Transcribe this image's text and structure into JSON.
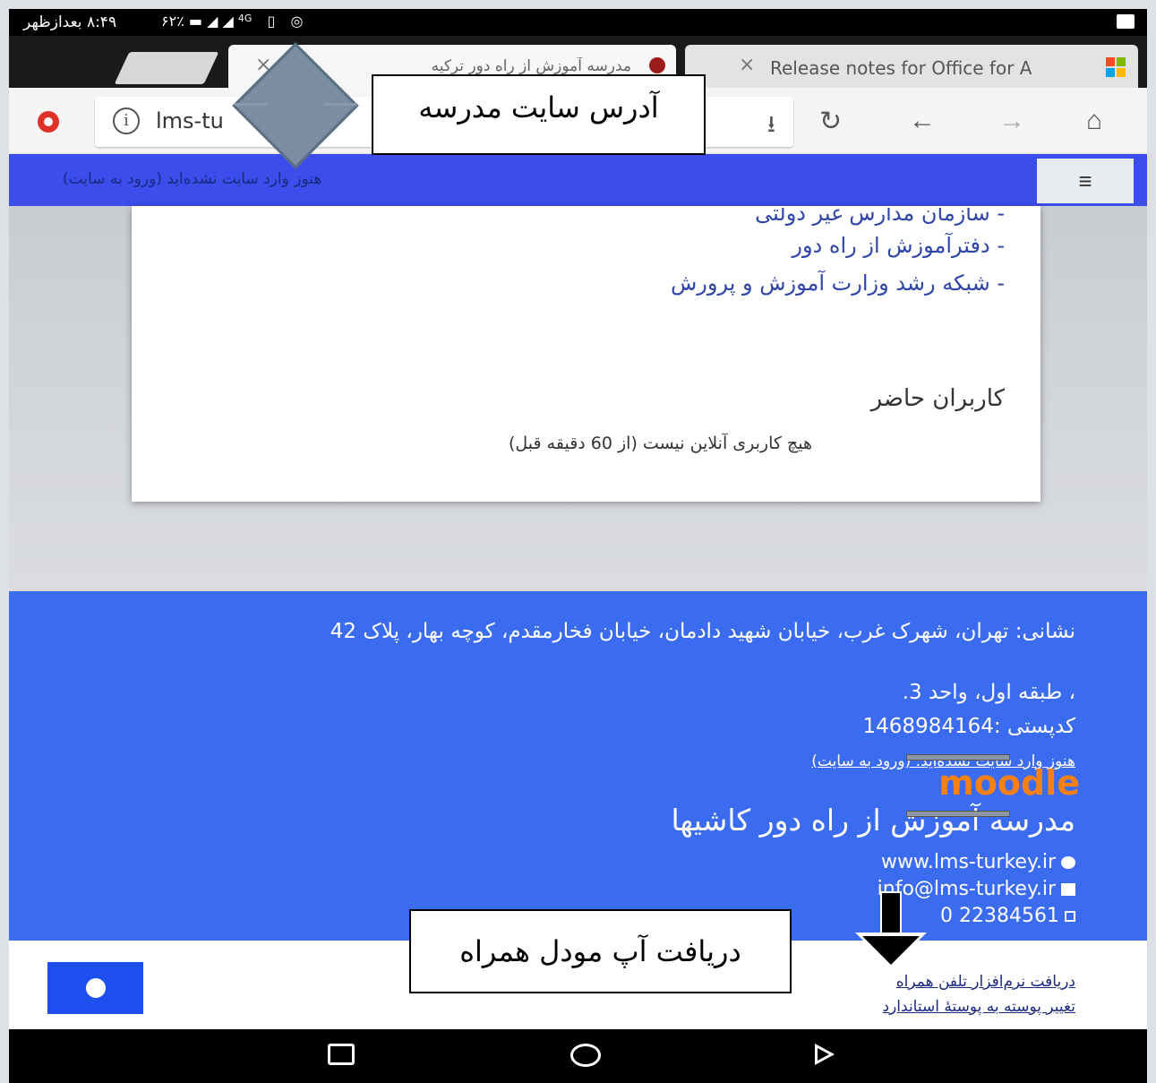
{
  "status_bar": {
    "time": "۸:۴۹ بعدازظهر",
    "battery": "۶۲٪",
    "network": "4G"
  },
  "tabs": [
    {
      "title": "مدرسه آموزش از راه دور ترکیه",
      "close": "×",
      "active": true
    },
    {
      "title": "Release notes for Office for A",
      "close": "×",
      "active": false
    }
  ],
  "toolbar": {
    "url": "lms-tu",
    "info_icon": "i",
    "download_icon": "⭳",
    "reload_icon": "↻",
    "back_icon": "←",
    "forward_icon": "→",
    "home_icon": "⌂"
  },
  "navbar": {
    "login_status": "هنوز وارد سایت نشده‌اید (ورود به سایت)",
    "menu_icon": "≡"
  },
  "card": {
    "links": [
      "- سازمان مدارس غیر دولتی",
      "- دفترآموزش از راه دور",
      "- شبکه رشد وزارت آموزش و پرورش"
    ],
    "online_title": "کاربران حاضر",
    "online_text": "هیچ کاربری آنلاین نیست (از 60 دقیقه قبل)"
  },
  "footer": {
    "address": "نشانی: تهران، شهرک غرب، خیابان شهید دادمان، خیابان فخارمقدم، کوچه بهار، پلاک 42",
    "floor": "، طبقه اول، واحد 3.",
    "postal": "کدپستی :1468984164",
    "login_status": "هنوز وارد سایت نشده‌اید. (ورود به سایت)",
    "moodle_logo": "moodle",
    "school_name": "مدرسه آموزش از راه دور کاشیها",
    "website": "www.lms-turkey.ir",
    "email": "info@lms-turkey.ir",
    "phone": "0  22384561",
    "mobile_app_link": "دریافت نرم‌افزار تلفن همراه",
    "standard_theme_link": "تغییر پوسته به پوستهٔ استاندارد"
  },
  "annotations": {
    "url_note": "آدرس سایت مدرسه",
    "app_note": "دریافت آپ مودل همراه"
  },
  "colors": {
    "navbar_bg": "#3b4dea",
    "footer_bg": "#3b6cf0",
    "link": "#2f45a8",
    "moodle_orange": "#f98012"
  }
}
